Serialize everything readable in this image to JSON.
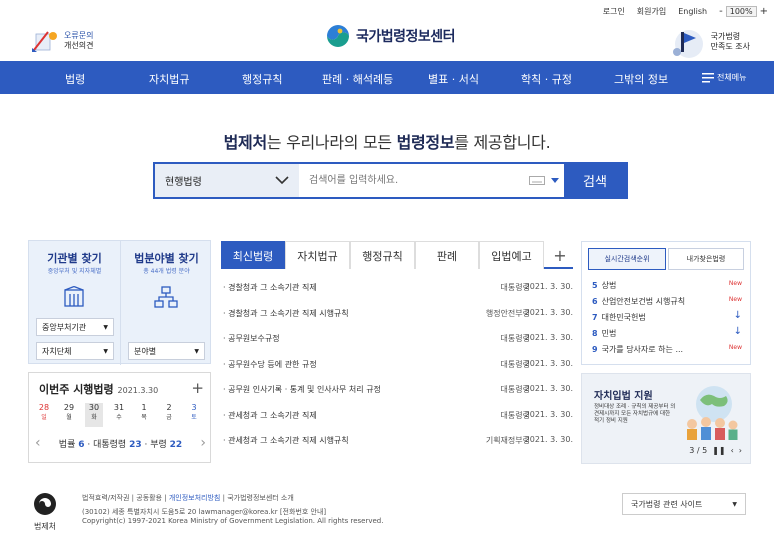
{
  "top_util": {
    "login": "로그인",
    "join": "회원가입",
    "english": "English",
    "zoom_minus": "-",
    "zoom_value": "100%",
    "zoom_plus": "+"
  },
  "header": {
    "feedback_line1": "오류문의",
    "feedback_line2": "개선의견",
    "logo_text": "국가법령정보센터",
    "survey_line1": "국가법령",
    "survey_line2": "만족도 조사"
  },
  "gnb": {
    "items": [
      "법령",
      "자치법규",
      "행정규칙",
      "판례 · 해석례등",
      "별표 · 서식",
      "학칙 · 규정",
      "그밖의 정보"
    ],
    "all_menu": "전체메뉴"
  },
  "hero": {
    "part1": "법제처",
    "part2": "는 우리나라의 모든 ",
    "part3": "법령정보",
    "part4": "를 제공합니다."
  },
  "search": {
    "select": "현행법령",
    "placeholder": "검색어를 입력하세요.",
    "button": "검색"
  },
  "finder": {
    "org_title": "기관별 찾기",
    "org_sub": "중앙부처 및 지자체별",
    "field_title": "법분야별 찾기",
    "field_sub": "총 44개 법령 분야",
    "dd_central": "중앙부처기관",
    "dd_local": "자치단체",
    "dd_field": "분야별"
  },
  "week": {
    "title": "이번주 시행법령",
    "date": "2021.3.30",
    "plus": "+",
    "days": [
      {
        "d": "28",
        "w": "일",
        "color": "#d33",
        "sel": false
      },
      {
        "d": "29",
        "w": "월",
        "color": "#333",
        "sel": false
      },
      {
        "d": "30",
        "w": "화",
        "color": "#333",
        "sel": true
      },
      {
        "d": "31",
        "w": "수",
        "color": "#333",
        "sel": false
      },
      {
        "d": "1",
        "w": "목",
        "color": "#333",
        "sel": false
      },
      {
        "d": "2",
        "w": "금",
        "color": "#333",
        "sel": false
      },
      {
        "d": "3",
        "w": "토",
        "color": "#2d5bc0",
        "sel": false
      }
    ],
    "law_label": "법률",
    "law_count": "6",
    "pres_label": "대통령령",
    "pres_count": "23",
    "min_label": "부령",
    "min_count": "22"
  },
  "tabs": [
    "최신법령",
    "자치법규",
    "행정규칙",
    "판례",
    "입법예고"
  ],
  "tab_plus": "+",
  "laws": [
    {
      "name": "· 경찰청과 그 소속기관 직제",
      "dept": "대통령령",
      "date": "2021. 3. 30."
    },
    {
      "name": "· 경찰청과 그 소속기관 직제 시행규칙",
      "dept": "행정안전부령",
      "date": "2021. 3. 30."
    },
    {
      "name": "· 공무원보수규정",
      "dept": "대통령령",
      "date": "2021. 3. 30."
    },
    {
      "name": "· 공무원수당 등에 관한 규정",
      "dept": "대통령령",
      "date": "2021. 3. 30."
    },
    {
      "name": "· 공무원 인사기록 · 통계 및 인사사무 처리 규정",
      "dept": "대통령령",
      "date": "2021. 3. 30."
    },
    {
      "name": "· 관세청과 그 소속기관 직제",
      "dept": "대통령령",
      "date": "2021. 3. 30."
    },
    {
      "name": "· 관세청과 그 소속기관 직제 시행규칙",
      "dept": "기획재정부령",
      "date": "2021. 3. 30."
    }
  ],
  "rank": {
    "tab1": "실시간검색순위",
    "tab2": "내가찾은법령",
    "items": [
      {
        "num": "5",
        "name": "상법",
        "status": "New"
      },
      {
        "num": "6",
        "name": "산업안전보건법 시행규칙",
        "status": "New"
      },
      {
        "num": "7",
        "name": "대한민국헌법",
        "status": "↓"
      },
      {
        "num": "8",
        "name": "민법",
        "status": "↓"
      },
      {
        "num": "9",
        "name": "국가를 당사자로 하는 ...",
        "status": "New"
      }
    ]
  },
  "banner": {
    "title": "자치입법 지원",
    "desc": "정비대상 조례 · 규칙의 제공부터 의견제시까지 모든 자치법규에 대한 적기 정비 지원",
    "page": "3 / 5"
  },
  "footer": {
    "logo_name": "법제처",
    "links": [
      "법적효력/저작권",
      "공동활용",
      "개인정보처리방침",
      "국가법령정보센터 소개"
    ],
    "addr": "(30102) 세종 특별자치시 도움5로 20 lawmanager@korea.kr [전화번호 안내]",
    "copy": "Copyright(c) 1997-2021 Korea Ministry of Government Legislation. All rights reserved.",
    "site_select": "국가법령 관련 사이트"
  },
  "colors": {
    "brand_blue": "#2d5bc0",
    "navy": "#1e2a55",
    "accent_red": "#d33"
  }
}
